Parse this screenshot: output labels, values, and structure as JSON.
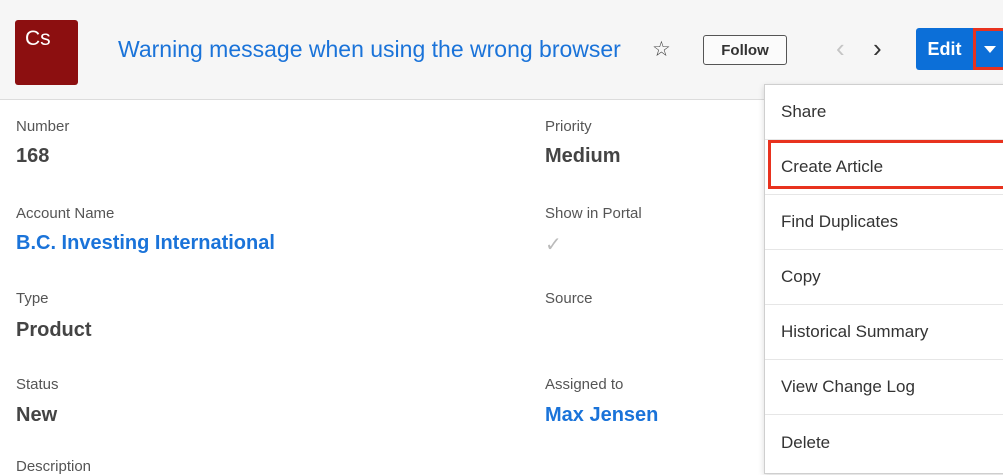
{
  "header": {
    "module_abbr": "Cs",
    "title": "Warning message when using the wrong browser",
    "favorite_icon": "☆",
    "follow_label": "Follow",
    "prev_icon": "‹",
    "next_icon": "›",
    "edit_label": "Edit"
  },
  "fields": {
    "number": {
      "label": "Number",
      "value": "168"
    },
    "priority": {
      "label": "Priority",
      "value": "Medium"
    },
    "account_name": {
      "label": "Account Name",
      "value": "B.C. Investing International"
    },
    "show_in_portal": {
      "label": "Show in Portal",
      "checked": true,
      "icon": "✓"
    },
    "type": {
      "label": "Type",
      "value": "Product"
    },
    "source": {
      "label": "Source",
      "value": ""
    },
    "status": {
      "label": "Status",
      "value": "New"
    },
    "assigned_to": {
      "label": "Assigned to",
      "value": "Max Jensen"
    },
    "description": {
      "label": "Description"
    }
  },
  "actions_menu": {
    "items": [
      "Share",
      "Create Article",
      "Find Duplicates",
      "Copy",
      "Historical Summary",
      "View Change Log",
      "Delete"
    ],
    "highlighted": "Create Article"
  },
  "colors": {
    "link": "#1a73d9",
    "primary_button": "#0c6fd8",
    "module_icon": "#8c0f10",
    "highlight": "#e8321e"
  }
}
